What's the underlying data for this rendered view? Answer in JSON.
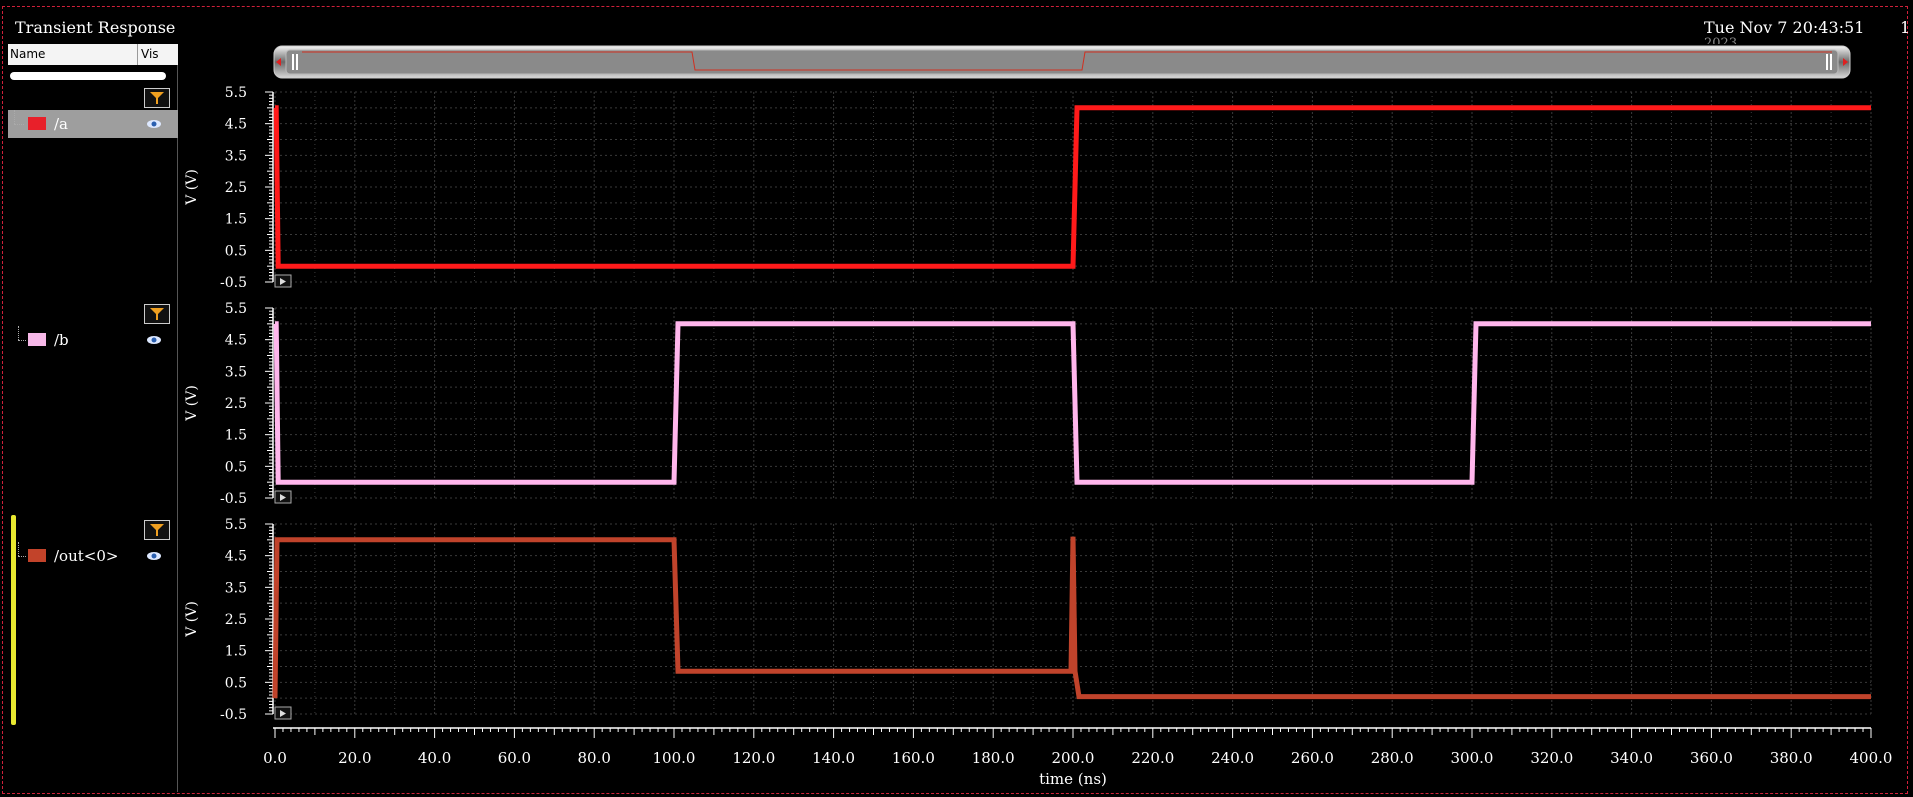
{
  "window": {
    "title": "Transient Response",
    "datetime": "Tue Nov 7 20:43:51",
    "datetime_overflow": "2023",
    "edge_text": "1"
  },
  "signal_list": {
    "columns": [
      "Name",
      "Vis"
    ],
    "signals": [
      {
        "name": "/a",
        "color": "#e8202a",
        "selected": true
      },
      {
        "name": "/b",
        "color": "#f7b8e8",
        "selected": false
      },
      {
        "name": "/out<0>",
        "color": "#c2432a",
        "selected": false
      }
    ]
  },
  "chart_data": {
    "type": "line",
    "xlabel": "time (ns)",
    "xlim": [
      0,
      400
    ],
    "xticks": [
      "0.0",
      "20.0",
      "40.0",
      "60.0",
      "80.0",
      "100.0",
      "120.0",
      "140.0",
      "160.0",
      "180.0",
      "200.0",
      "220.0",
      "240.0",
      "260.0",
      "280.0",
      "300.0",
      "320.0",
      "340.0",
      "360.0",
      "380.0",
      "400.0"
    ],
    "grid": true,
    "panels": [
      {
        "series": "/a",
        "color": "#ff1a1a",
        "ylabel": "V (V)",
        "ylim": [
          -0.5,
          5.5
        ],
        "yticks": [
          "5.5",
          "4.5",
          "3.5",
          "2.5",
          "1.5",
          "0.5",
          "-0.5"
        ],
        "points": [
          [
            0,
            5.0
          ],
          [
            0.3,
            5.0
          ],
          [
            0.8,
            0.0
          ],
          [
            200,
            0.0
          ],
          [
            201,
            5.0
          ],
          [
            400,
            5.0
          ]
        ]
      },
      {
        "series": "/b",
        "color": "#ffb6ec",
        "ylabel": "V (V)",
        "ylim": [
          -0.5,
          5.5
        ],
        "yticks": [
          "5.5",
          "4.5",
          "3.5",
          "2.5",
          "1.5",
          "0.5",
          "-0.5"
        ],
        "points": [
          [
            0,
            5.0
          ],
          [
            0.3,
            5.0
          ],
          [
            0.8,
            0.0
          ],
          [
            100,
            0.0
          ],
          [
            101,
            5.0
          ],
          [
            200,
            5.0
          ],
          [
            201,
            0.0
          ],
          [
            300,
            0.0
          ],
          [
            301,
            5.0
          ],
          [
            400,
            5.0
          ]
        ]
      },
      {
        "series": "/out<0>",
        "color": "#c0432b",
        "ylabel": "V (V)",
        "ylim": [
          -0.5,
          5.5
        ],
        "yticks": [
          "5.5",
          "4.5",
          "3.5",
          "2.5",
          "1.5",
          "0.5",
          "-0.5"
        ],
        "points": [
          [
            0,
            0.0
          ],
          [
            0.5,
            5.0
          ],
          [
            100,
            5.0
          ],
          [
            101,
            0.85
          ],
          [
            199.5,
            0.85
          ],
          [
            200,
            5.1
          ],
          [
            200.5,
            0.85
          ],
          [
            201.5,
            0.05
          ],
          [
            400,
            0.05
          ]
        ]
      }
    ]
  },
  "overview": {
    "color": "#e03020"
  }
}
